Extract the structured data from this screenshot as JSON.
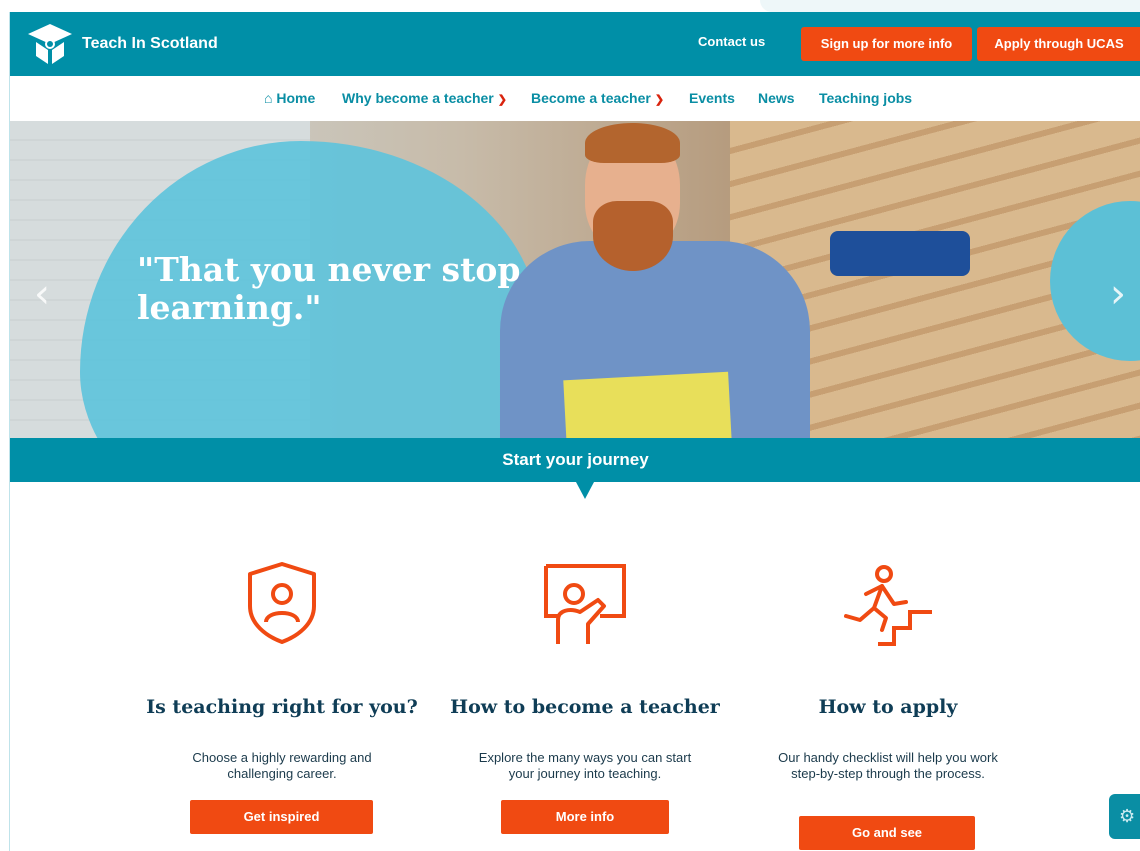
{
  "header": {
    "logo_text": "Teach In Scotland",
    "contact": "Contact us",
    "signup": "Sign up for more info",
    "ucas": "Apply through UCAS"
  },
  "nav": {
    "items": [
      {
        "label": "Home",
        "icon": "home-icon"
      },
      {
        "label": "Why become a teacher",
        "dropdown": true
      },
      {
        "label": "Become a teacher",
        "dropdown": true
      },
      {
        "label": "Events"
      },
      {
        "label": "News"
      },
      {
        "label": "Teaching jobs"
      }
    ]
  },
  "hero": {
    "quote": "\"That you never stop learning.\""
  },
  "journey": {
    "title": "Start your journey"
  },
  "cards": [
    {
      "icon": "shield-person-icon",
      "title": "Is teaching right for you?",
      "description": "Choose a highly rewarding and challenging career.",
      "button": "Get inspired"
    },
    {
      "icon": "teacher-board-icon",
      "title": "How to become a teacher",
      "description": "Explore the many ways you can start your journey into teaching.",
      "button": "More info"
    },
    {
      "icon": "person-climbing-stairs-icon",
      "title": "How to apply",
      "description": "Our handy checklist will help you work step-by-step through the process.",
      "button": "Go and see"
    }
  ],
  "colors": {
    "teal": "#008fa7",
    "orange": "#f04a12",
    "navy": "#0f3d56",
    "sky_blue": "#5fc3db"
  }
}
